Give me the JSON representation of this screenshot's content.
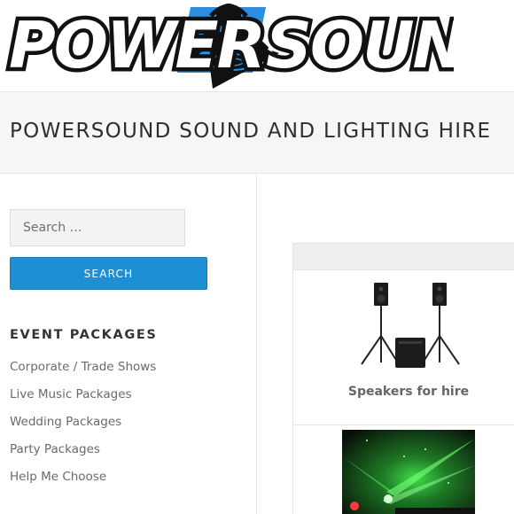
{
  "logo": {
    "text_left": "POWER",
    "text_right": "SOUND",
    "colors": {
      "black": "#111111",
      "blue": "#2b8ee0",
      "white": "#ffffff"
    }
  },
  "site": {
    "title": "POWERSOUND SOUND AND LIGHTING HIRE"
  },
  "search": {
    "placeholder": "Search …",
    "button_label": "SEARCH"
  },
  "sidebar": {
    "widget_title": "EVENT PACKAGES",
    "items": [
      {
        "label": "Corporate / Trade Shows"
      },
      {
        "label": "Live Music Packages"
      },
      {
        "label": "Wedding Packages"
      },
      {
        "label": "Party Packages"
      },
      {
        "label": "Help Me Choose"
      }
    ]
  },
  "products": [
    {
      "label": "Speakers for hire",
      "image": "speakers-on-stands-with-subwoofer"
    },
    {
      "label": "",
      "image": "green-laser-light-show"
    }
  ],
  "colors": {
    "accent": "#1e8fd5",
    "title_band": "#f5f6f6",
    "link_gray": "#6a6a6a"
  }
}
